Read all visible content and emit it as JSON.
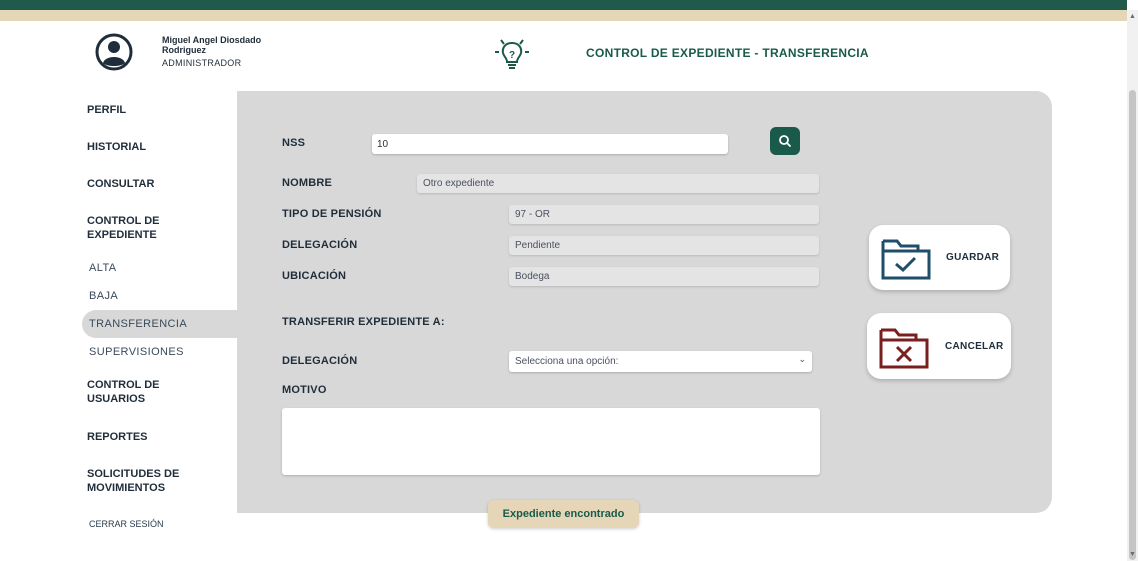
{
  "header": {
    "user_name": "Miguel Angel Diosdado Rodriguez",
    "user_role": "ADMINISTRADOR",
    "page_title": "CONTROL DE EXPEDIENTE - TRANSFERENCIA"
  },
  "sidebar": {
    "perfil": "PERFIL",
    "historial": "HISTORIAL",
    "consultar": "CONSULTAR",
    "control_expediente": "CONTROL DE EXPEDIENTE",
    "alta": "ALTA",
    "baja": "BAJA",
    "transferencia": "TRANSFERENCIA",
    "supervisiones": "SUPERVISIONES",
    "control_usuarios": "CONTROL DE USUARIOS",
    "reportes": "REPORTES",
    "solicitudes": "SOLICITUDES DE MOVIMIENTOS",
    "cerrar_sesion": "CERRAR SESIÓN"
  },
  "form": {
    "nss_label": "NSS",
    "nss_value": "10",
    "nombre_label": "NOMBRE",
    "nombre_value": "Otro expediente",
    "tipo_pension_label": "TIPO DE PENSIÓN",
    "tipo_pension_value": "97 - OR",
    "delegacion_label": "DELEGACIÓN",
    "delegacion_value": "Pendiente",
    "ubicacion_label": "UBICACIÓN",
    "ubicacion_value": "Bodega",
    "transferir_label": "TRANSFERIR EXPEDIENTE A:",
    "destino_delegacion_label": "DELEGACIÓN",
    "destino_delegacion_value": "Selecciona una opción:",
    "motivo_label": "MOTIVO"
  },
  "actions": {
    "guardar": "GUARDAR",
    "cancelar": "CANCELAR"
  },
  "status": {
    "message": "Expediente encontrado"
  },
  "colors": {
    "brand_green": "#1a5a4a",
    "sand": "#e6d6b8",
    "panel_gray": "#d8d8d8",
    "save_icon": "#1f4e6b",
    "cancel_icon": "#7a1f1f"
  },
  "icons": {
    "avatar": "user-circle-icon",
    "logo": "lightbulb-logo-icon",
    "search": "search-icon",
    "save": "folder-check-icon",
    "cancel": "folder-x-icon",
    "select": "chevron-down-icon"
  }
}
